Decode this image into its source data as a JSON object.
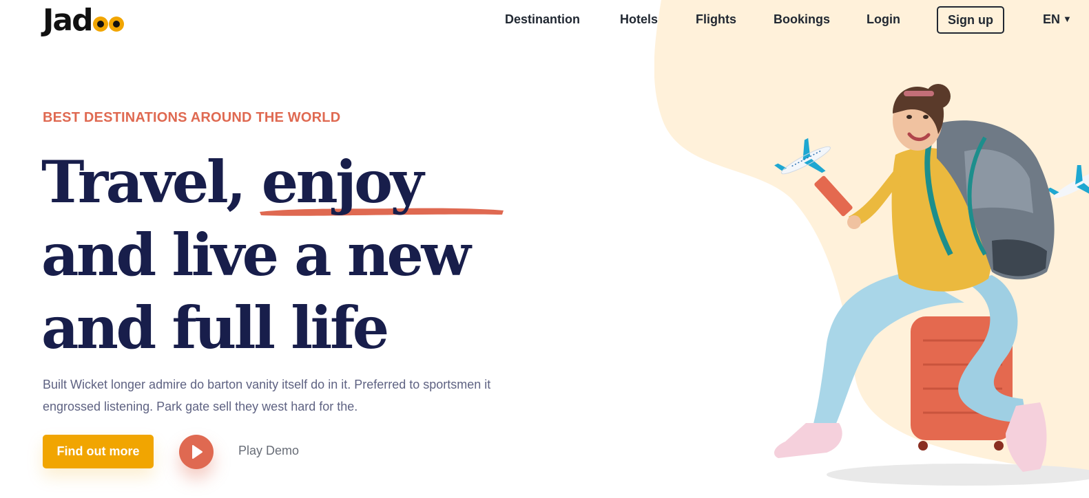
{
  "brand": {
    "logo_text": "Jad",
    "logo_accent": "oo",
    "accent_color": "#f1a501"
  },
  "nav": {
    "items": [
      "Destinantion",
      "Hotels",
      "Flights",
      "Bookings",
      "Login"
    ],
    "signup_label": "Sign up",
    "language": "EN"
  },
  "hero": {
    "eyebrow": "BEST DESTINATIONS AROUND THE WORLD",
    "headline_lines": [
      "Travel, enjoy",
      "and live a new",
      "and full life"
    ],
    "description": "Built Wicket longer admire do barton vanity itself do in it. Preferred to sportsmen it engrossed listening. Park gate sell they west hard for the.",
    "cta_label": "Find out more",
    "play_label": "Play Demo"
  },
  "colors": {
    "primary_dark": "#181e4b",
    "coral": "#df6951",
    "yellow": "#f1a501",
    "blob": "#fff1da",
    "text_muted": "#5e6282"
  }
}
